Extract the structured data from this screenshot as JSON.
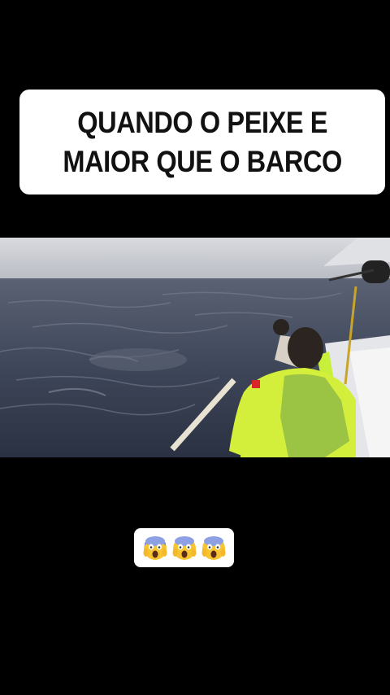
{
  "caption": {
    "text": "QUANDO O PEIXE E\nMAIOR QUE O BARCO"
  },
  "reaction": {
    "emojis": [
      "😱",
      "😱",
      "😱"
    ],
    "icon": "face-screaming-in-fear"
  },
  "colors": {
    "background": "#000000",
    "caption_bg": "#ffffff",
    "sea": "#3b4558",
    "sky": "#c9ccd2",
    "shirt": "#d4ef3a"
  }
}
